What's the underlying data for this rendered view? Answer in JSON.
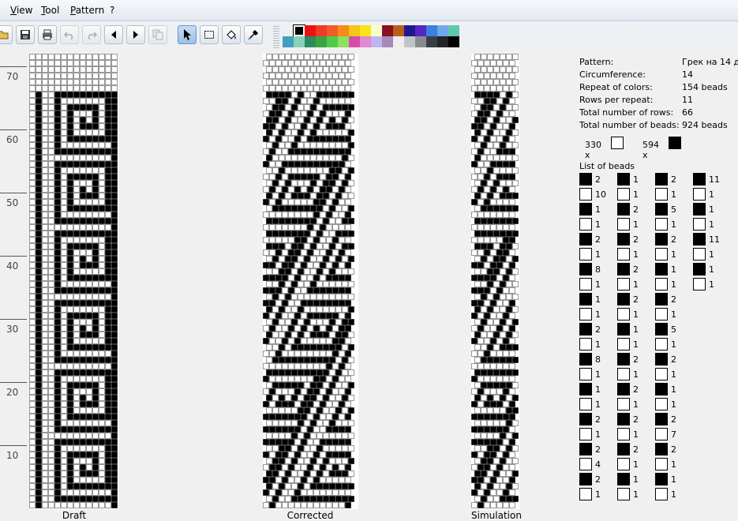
{
  "menubar": {
    "items": [
      "View",
      "Tool",
      "Pattern",
      "?"
    ]
  },
  "toolbar": {
    "buttons": [
      "open-icon",
      "save-icon",
      "print-icon",
      "undo-icon",
      "redo-icon",
      "prev-icon",
      "next-icon",
      "copy-icon",
      "pointer-icon",
      "select-icon",
      "fill-icon",
      "picker-icon"
    ],
    "selected_tool": "pointer-icon"
  },
  "palette": {
    "row1": [
      "#000000",
      "#ee1111",
      "#f03a2a",
      "#f25c25",
      "#f68a1e",
      "#f5c518",
      "#f7e51a",
      "#fbfbd0",
      "#8a1020",
      "#b85f1c",
      "#201890",
      "#5526c0",
      "#3b7fe0",
      "#6fa8e8",
      "#5cc8b0"
    ],
    "row2": [
      "#41a0c0",
      "#8ad0b8",
      "#2e8a60",
      "#3aa640",
      "#50cc48",
      "#8ee060",
      "#d44ca8",
      "#e08ad0",
      "#c0b4f0",
      "#a88ab8",
      "#eeeef0",
      "#c0c4c8",
      "#888c90",
      "#3a3e44",
      "#222428",
      "#000000"
    ]
  },
  "ruler": {
    "labels": [
      "70",
      "60",
      "50",
      "40",
      "30",
      "20",
      "10"
    ]
  },
  "panels": {
    "draft": "Draft",
    "corrected": "Corrected",
    "simulation": "Simulation"
  },
  "info": {
    "pattern_label": "Pattern:",
    "pattern_value": "Грек на 14 д",
    "circumference_label": "Circumference:",
    "circumference_value": "14",
    "repeat_label": "Repeat of colors:",
    "repeat_value": "154 beads",
    "rows_per_repeat_label": "Rows per repeat:",
    "rows_per_repeat_value": "11",
    "total_rows_label": "Total number of rows:",
    "total_rows_value": "66",
    "total_beads_label": "Total number of beads:",
    "total_beads_value": "924 beads",
    "count_white": "330 x",
    "count_black": "594 x",
    "list_title": "List of beads"
  },
  "bead_list": [
    [
      [
        "b",
        "2"
      ],
      [
        "w",
        "10"
      ],
      [
        "b",
        "1"
      ],
      [
        "w",
        "1"
      ],
      [
        "b",
        "2"
      ],
      [
        "w",
        "1"
      ],
      [
        "b",
        "8"
      ],
      [
        "w",
        "1"
      ],
      [
        "b",
        "1"
      ],
      [
        "w",
        "1"
      ],
      [
        "b",
        "2"
      ],
      [
        "w",
        "1"
      ],
      [
        "b",
        "8"
      ],
      [
        "w",
        "1"
      ],
      [
        "b",
        "1"
      ],
      [
        "w",
        "1"
      ],
      [
        "b",
        "2"
      ],
      [
        "w",
        "1"
      ],
      [
        "b",
        "2"
      ],
      [
        "w",
        "4"
      ],
      [
        "b",
        "2"
      ],
      [
        "w",
        "1"
      ]
    ],
    [
      [
        "b",
        "1"
      ],
      [
        "w",
        "1"
      ],
      [
        "b",
        "2"
      ],
      [
        "w",
        "1"
      ],
      [
        "b",
        "2"
      ],
      [
        "w",
        "1"
      ],
      [
        "b",
        "2"
      ],
      [
        "w",
        "1"
      ],
      [
        "b",
        "2"
      ],
      [
        "w",
        "1"
      ],
      [
        "b",
        "1"
      ],
      [
        "w",
        "1"
      ],
      [
        "b",
        "2"
      ],
      [
        "w",
        "1"
      ],
      [
        "b",
        "2"
      ],
      [
        "w",
        "1"
      ],
      [
        "b",
        "2"
      ],
      [
        "w",
        "1"
      ],
      [
        "b",
        "2"
      ],
      [
        "w",
        "1"
      ],
      [
        "b",
        "1"
      ],
      [
        "w",
        "1"
      ]
    ],
    [
      [
        "b",
        "2"
      ],
      [
        "w",
        "1"
      ],
      [
        "b",
        "5"
      ],
      [
        "w",
        "1"
      ],
      [
        "b",
        "2"
      ],
      [
        "w",
        "1"
      ],
      [
        "b",
        "1"
      ],
      [
        "w",
        "1"
      ],
      [
        "b",
        "2"
      ],
      [
        "w",
        "1"
      ],
      [
        "b",
        "5"
      ],
      [
        "w",
        "1"
      ],
      [
        "b",
        "2"
      ],
      [
        "w",
        "1"
      ],
      [
        "b",
        "1"
      ],
      [
        "w",
        "1"
      ],
      [
        "b",
        "2"
      ],
      [
        "w",
        "7"
      ],
      [
        "b",
        "2"
      ],
      [
        "w",
        "1"
      ],
      [
        "b",
        "1"
      ],
      [
        "w",
        "1"
      ]
    ],
    [
      [
        "b",
        "11"
      ],
      [
        "w",
        "1"
      ],
      [
        "b",
        "1"
      ],
      [
        "w",
        "1"
      ],
      [
        "b",
        "11"
      ],
      [
        "w",
        "1"
      ],
      [
        "b",
        "1"
      ],
      [
        "w",
        "1"
      ]
    ]
  ]
}
